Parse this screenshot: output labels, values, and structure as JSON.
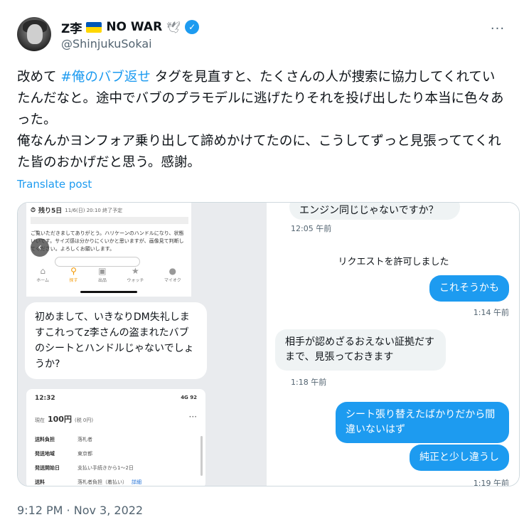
{
  "author": {
    "display_name": "Z李",
    "suffix": "NO WAR",
    "handle": "@ShinjukuSokai",
    "flag_colors": [
      "#0057b7",
      "#ffd700"
    ],
    "icons": [
      "ukraine-flag-icon",
      "dove-icon",
      "verified-badge-icon"
    ],
    "more_label": "···"
  },
  "tweet": {
    "line1_pre": "改めて ",
    "hashtag": "#俺のバブ返せ",
    "line1_post": " タグを見直すと、たくさんの人が捜索に協力してくれていたんだなと。途中でバブのプラモデルに逃げたりそれを投げ出したり本当に色々あった。",
    "line2": "俺なんかヨンフォア乗り出して諦めかけてたのに、こうしてずっと見張っててくれた皆のおかげだと思う。感謝。",
    "translate_label": "Translate post",
    "timestamp": "9:12 PM · Nov 3, 2022"
  },
  "media_left": {
    "shop": {
      "timer_label": "残り5日",
      "timer_sub": "11/6(日) 20:10 終了予定",
      "description": "ご覧いただきましてありがとう。ハリケーンのハンドルになり、状態いいです。サイズ感は分かりにくいかと思いますが、画像見て判断してください。よろしくお願いします。",
      "nav": [
        "ホーム",
        "探す",
        "出品",
        "ウォッチ",
        "マイオク"
      ]
    },
    "back_icon": "‹",
    "dm_message": "初めまして、いきなりDM失礼しますこれってz李さんの盗まれたバブのシートとハンドルじゃないでしょうか?",
    "auction": {
      "time": "12:32",
      "signal": "4G",
      "battery": "92",
      "price_label": "現在",
      "price": "100円",
      "price_sub": "(税 0円)",
      "rows": [
        {
          "k": "送料負担",
          "v": "落札者"
        },
        {
          "k": "発送地域",
          "v": "東京都"
        },
        {
          "k": "発送開始日",
          "v": "支払い手続きから1～2日"
        },
        {
          "k": "送料",
          "v": "落札者負担（着払い）",
          "link": "詳細"
        }
      ]
    }
  },
  "media_right": {
    "msg_top": "エンジン同じじゃないですか？",
    "time1": "12:05 午前",
    "system": "リクエストを許可しました",
    "out1": "これそうかも",
    "time2": "1:14 午前",
    "in1": "相手が認めざるおえない証拠だすまで、見張っておきます",
    "time3": "1:18 午前",
    "out2": "シート張り替えたばかりだから間違いないはず",
    "out3": "純正と少し違うし",
    "time4": "1:19 午前"
  }
}
